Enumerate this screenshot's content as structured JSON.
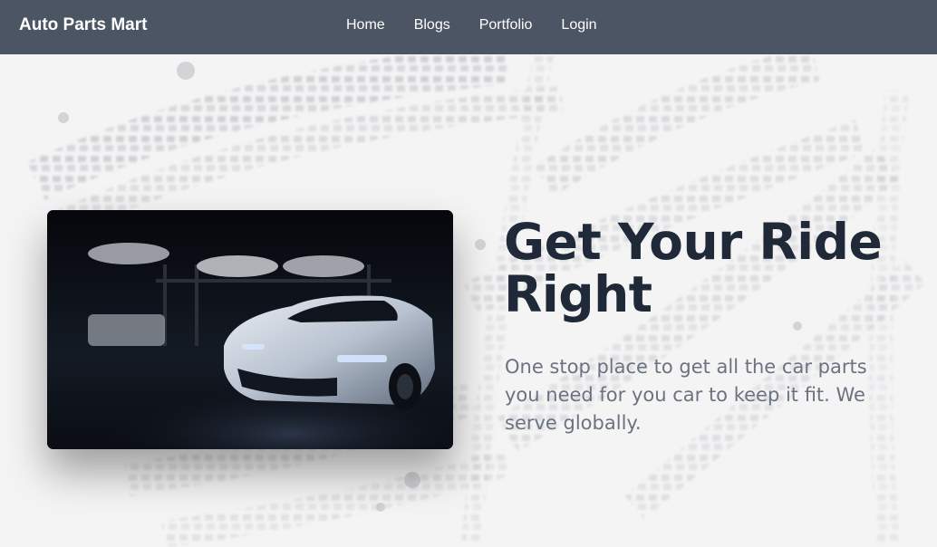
{
  "navbar": {
    "brand": "Auto Parts Mart",
    "links": [
      {
        "label": "Home"
      },
      {
        "label": "Blogs"
      },
      {
        "label": "Portfolio"
      },
      {
        "label": "Login"
      }
    ]
  },
  "hero": {
    "title": "Get Your Ride Right",
    "subtitle": "One stop place to get all the car parts you need for you car to keep it fit. We serve globally.",
    "image_alt": "sports-car-in-garage"
  },
  "colors": {
    "navbar_bg": "#4b5563",
    "title": "#1f2937",
    "subtitle": "#6b7280"
  }
}
